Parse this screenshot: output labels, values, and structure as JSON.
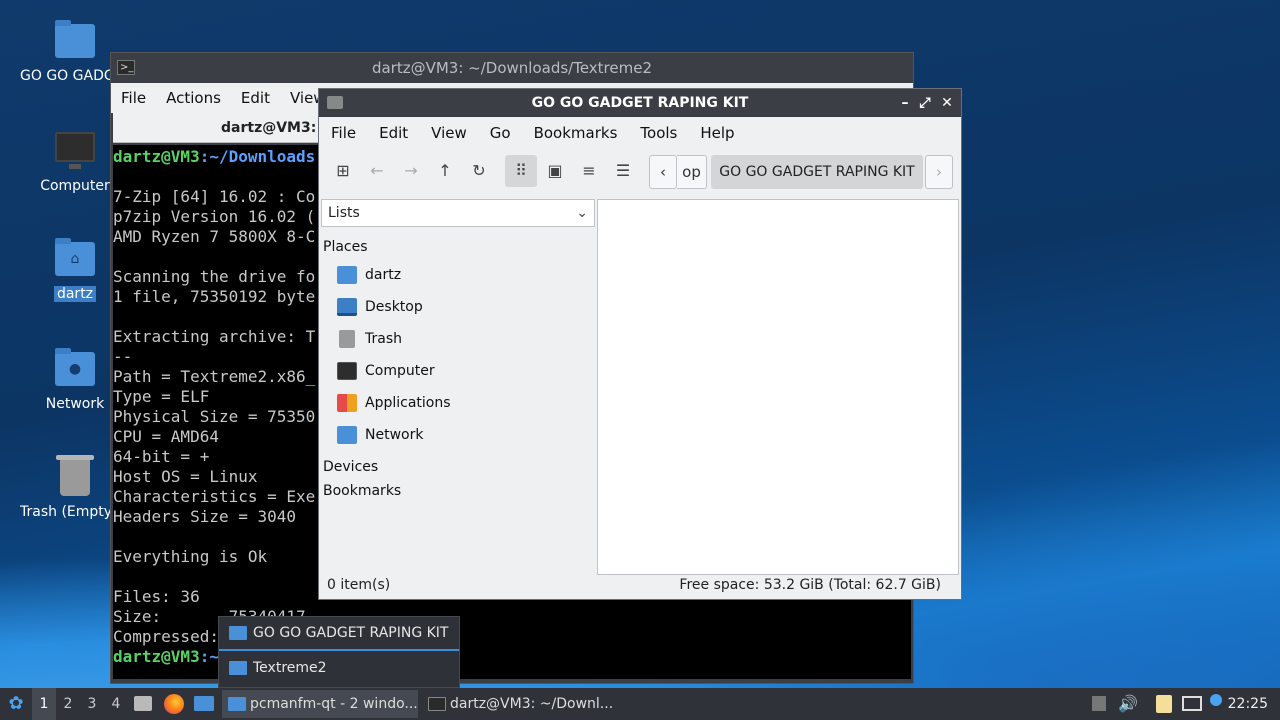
{
  "desktop": {
    "icons": [
      {
        "label": "GO GO GADGET RAPING KIT",
        "icon": "folder-icon"
      },
      {
        "label": "Computer",
        "icon": "computer-icon"
      },
      {
        "label": "dartz",
        "icon": "home-folder-icon"
      },
      {
        "label": "Network",
        "icon": "network-folder-icon"
      },
      {
        "label": "Trash (Empty)",
        "icon": "trash-icon"
      }
    ]
  },
  "terminal": {
    "title": "dartz@VM3: ~/Downloads/Textreme2",
    "menu": [
      "File",
      "Actions",
      "Edit",
      "View"
    ],
    "tab": "dartz@VM3:",
    "prompt_user": "dartz@VM3",
    "prompt_path": ":~/Downloads",
    "lines": [
      "",
      "7-Zip [64] 16.02 : Co",
      "p7zip Version 16.02 (",
      "AMD Ryzen 7 5800X 8-C",
      "",
      "Scanning the drive fo",
      "1 file, 75350192 byte",
      "",
      "Extracting archive: T",
      "--",
      "Path = Textreme2.x86_",
      "Type = ELF",
      "Physical Size = 75350",
      "CPU = AMD64",
      "64-bit = +",
      "Host OS = Linux",
      "Characteristics = Exe",
      "Headers Size = 3040",
      "",
      "Everything is Ok",
      "",
      "Files: 36",
      "Size:       75340417",
      "Compressed:"
    ],
    "last_prompt_user": "dartz@VM3",
    "last_prompt_path": ":~"
  },
  "filemanager": {
    "title": "GO GO GADGET RAPING KIT",
    "menu": [
      "File",
      "Edit",
      "View",
      "Go",
      "Bookmarks",
      "Tools",
      "Help"
    ],
    "crumb_prev": "op",
    "crumb_current": "GO GO GADGET RAPING KIT",
    "side_mode": "Lists",
    "places_header": "Places",
    "places": [
      {
        "label": "dartz",
        "icon": "home-icon"
      },
      {
        "label": "Desktop",
        "icon": "desktop-icon"
      },
      {
        "label": "Trash",
        "icon": "trash-icon"
      },
      {
        "label": "Computer",
        "icon": "computer-icon"
      },
      {
        "label": "Applications",
        "icon": "applications-icon"
      },
      {
        "label": "Network",
        "icon": "network-icon"
      }
    ],
    "devices_header": "Devices",
    "bookmarks_header": "Bookmarks",
    "status_items": "0 item(s)",
    "status_space": "Free space: 53.2 GiB (Total: 62.7 GiB)"
  },
  "popup": {
    "items": [
      "GO GO GADGET RAPING KIT",
      "Textreme2"
    ]
  },
  "taskbar": {
    "desktops": [
      "1",
      "2",
      "3",
      "4"
    ],
    "task_fm": "pcmanfm-qt - 2 windo...",
    "task_term": "dartz@VM3: ~/Downl...",
    "clock": "22:25"
  }
}
